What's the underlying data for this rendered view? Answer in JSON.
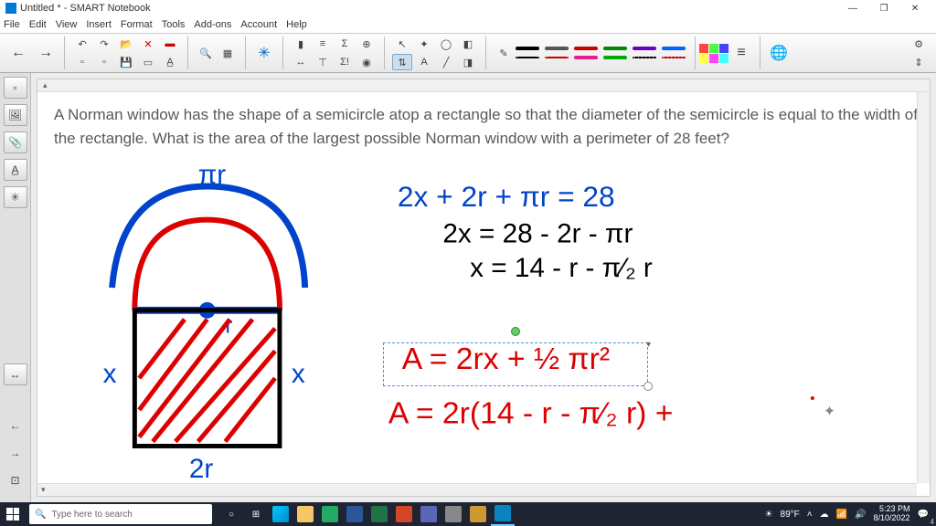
{
  "window": {
    "title": "Untitled * - SMART Notebook"
  },
  "winControls": {
    "min": "—",
    "max": "❐",
    "close": "✕"
  },
  "menu": [
    "File",
    "Edit",
    "View",
    "Insert",
    "Format",
    "Tools",
    "Add-ons",
    "Account",
    "Help"
  ],
  "problem": "A Norman window has the shape of a semicircle atop a rectangle so that the diameter of the semicircle is equal to the width of the rectangle. What is the area of the largest possible Norman window with a perimeter of 28 feet?",
  "math": {
    "arc_label": "πr",
    "r_label": "r",
    "x_left": "x",
    "x_right": "x",
    "base": "2r",
    "eq1": "2x + 2r + πr =  28",
    "eq2": "2x = 28 - 2r - πr",
    "eq3": "x = 14 - r - π⁄₂ r",
    "eq4": "A =  2rx + ½ πr²",
    "eq5": "A = 2r(14 - r - π⁄₂ r) +"
  },
  "taskbar": {
    "search_placeholder": "Type here to search",
    "weather": "89°F",
    "time": "5:23 PM",
    "date": "8/10/2022",
    "page": "4"
  },
  "penColors": [
    "#000000",
    "#333333",
    "#cc0000",
    "#008800",
    "#6600cc",
    "#0066ff",
    "#000000",
    "#cc0000",
    "#e91e8c",
    "#009900",
    "#000000",
    "#cc0000"
  ]
}
